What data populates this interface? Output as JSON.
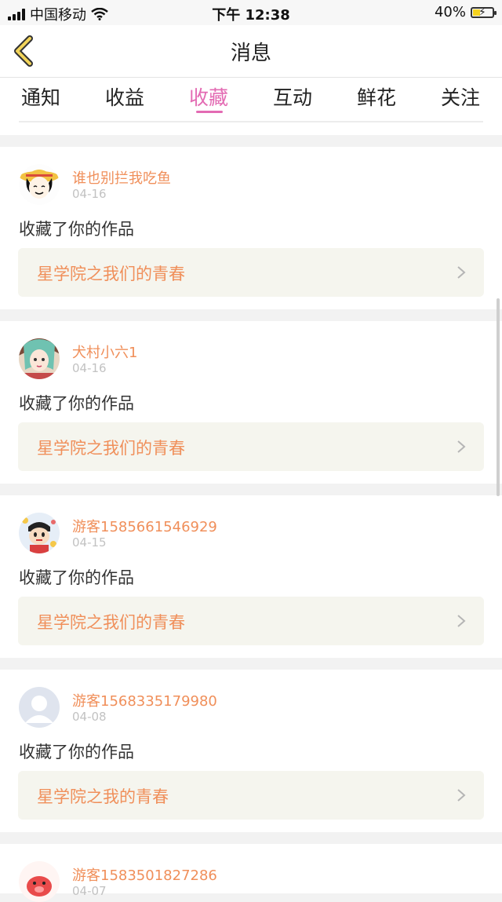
{
  "status": {
    "carrier": "中国移动",
    "time": "下午 12:38",
    "battery": "40%"
  },
  "nav": {
    "title": "消息"
  },
  "tabs": [
    {
      "label": "通知"
    },
    {
      "label": "收益"
    },
    {
      "label": "收藏"
    },
    {
      "label": "互动"
    },
    {
      "label": "鲜花"
    },
    {
      "label": "关注"
    }
  ],
  "active_tab": "收藏",
  "items": [
    {
      "user": "谁也别拦我吃鱼",
      "date": "04-16",
      "action": "收藏了你的作品",
      "work": "星学院之我们的青春"
    },
    {
      "user": "犬村小六1",
      "date": "04-16",
      "action": "收藏了你的作品",
      "work": "星学院之我们的青春"
    },
    {
      "user": "游客1585661546929",
      "date": "04-15",
      "action": "收藏了你的作品",
      "work": "星学院之我们的青春"
    },
    {
      "user": "游客1568335179980",
      "date": "04-08",
      "action": "收藏了你的作品",
      "work": "星学院之我的青春"
    },
    {
      "user": "游客1583501827286",
      "date": "04-07",
      "action": "",
      "work": ""
    }
  ],
  "colors": {
    "accent": "#e36bb3",
    "username": "#f08f5a",
    "work_bg": "#f5f5ee"
  }
}
